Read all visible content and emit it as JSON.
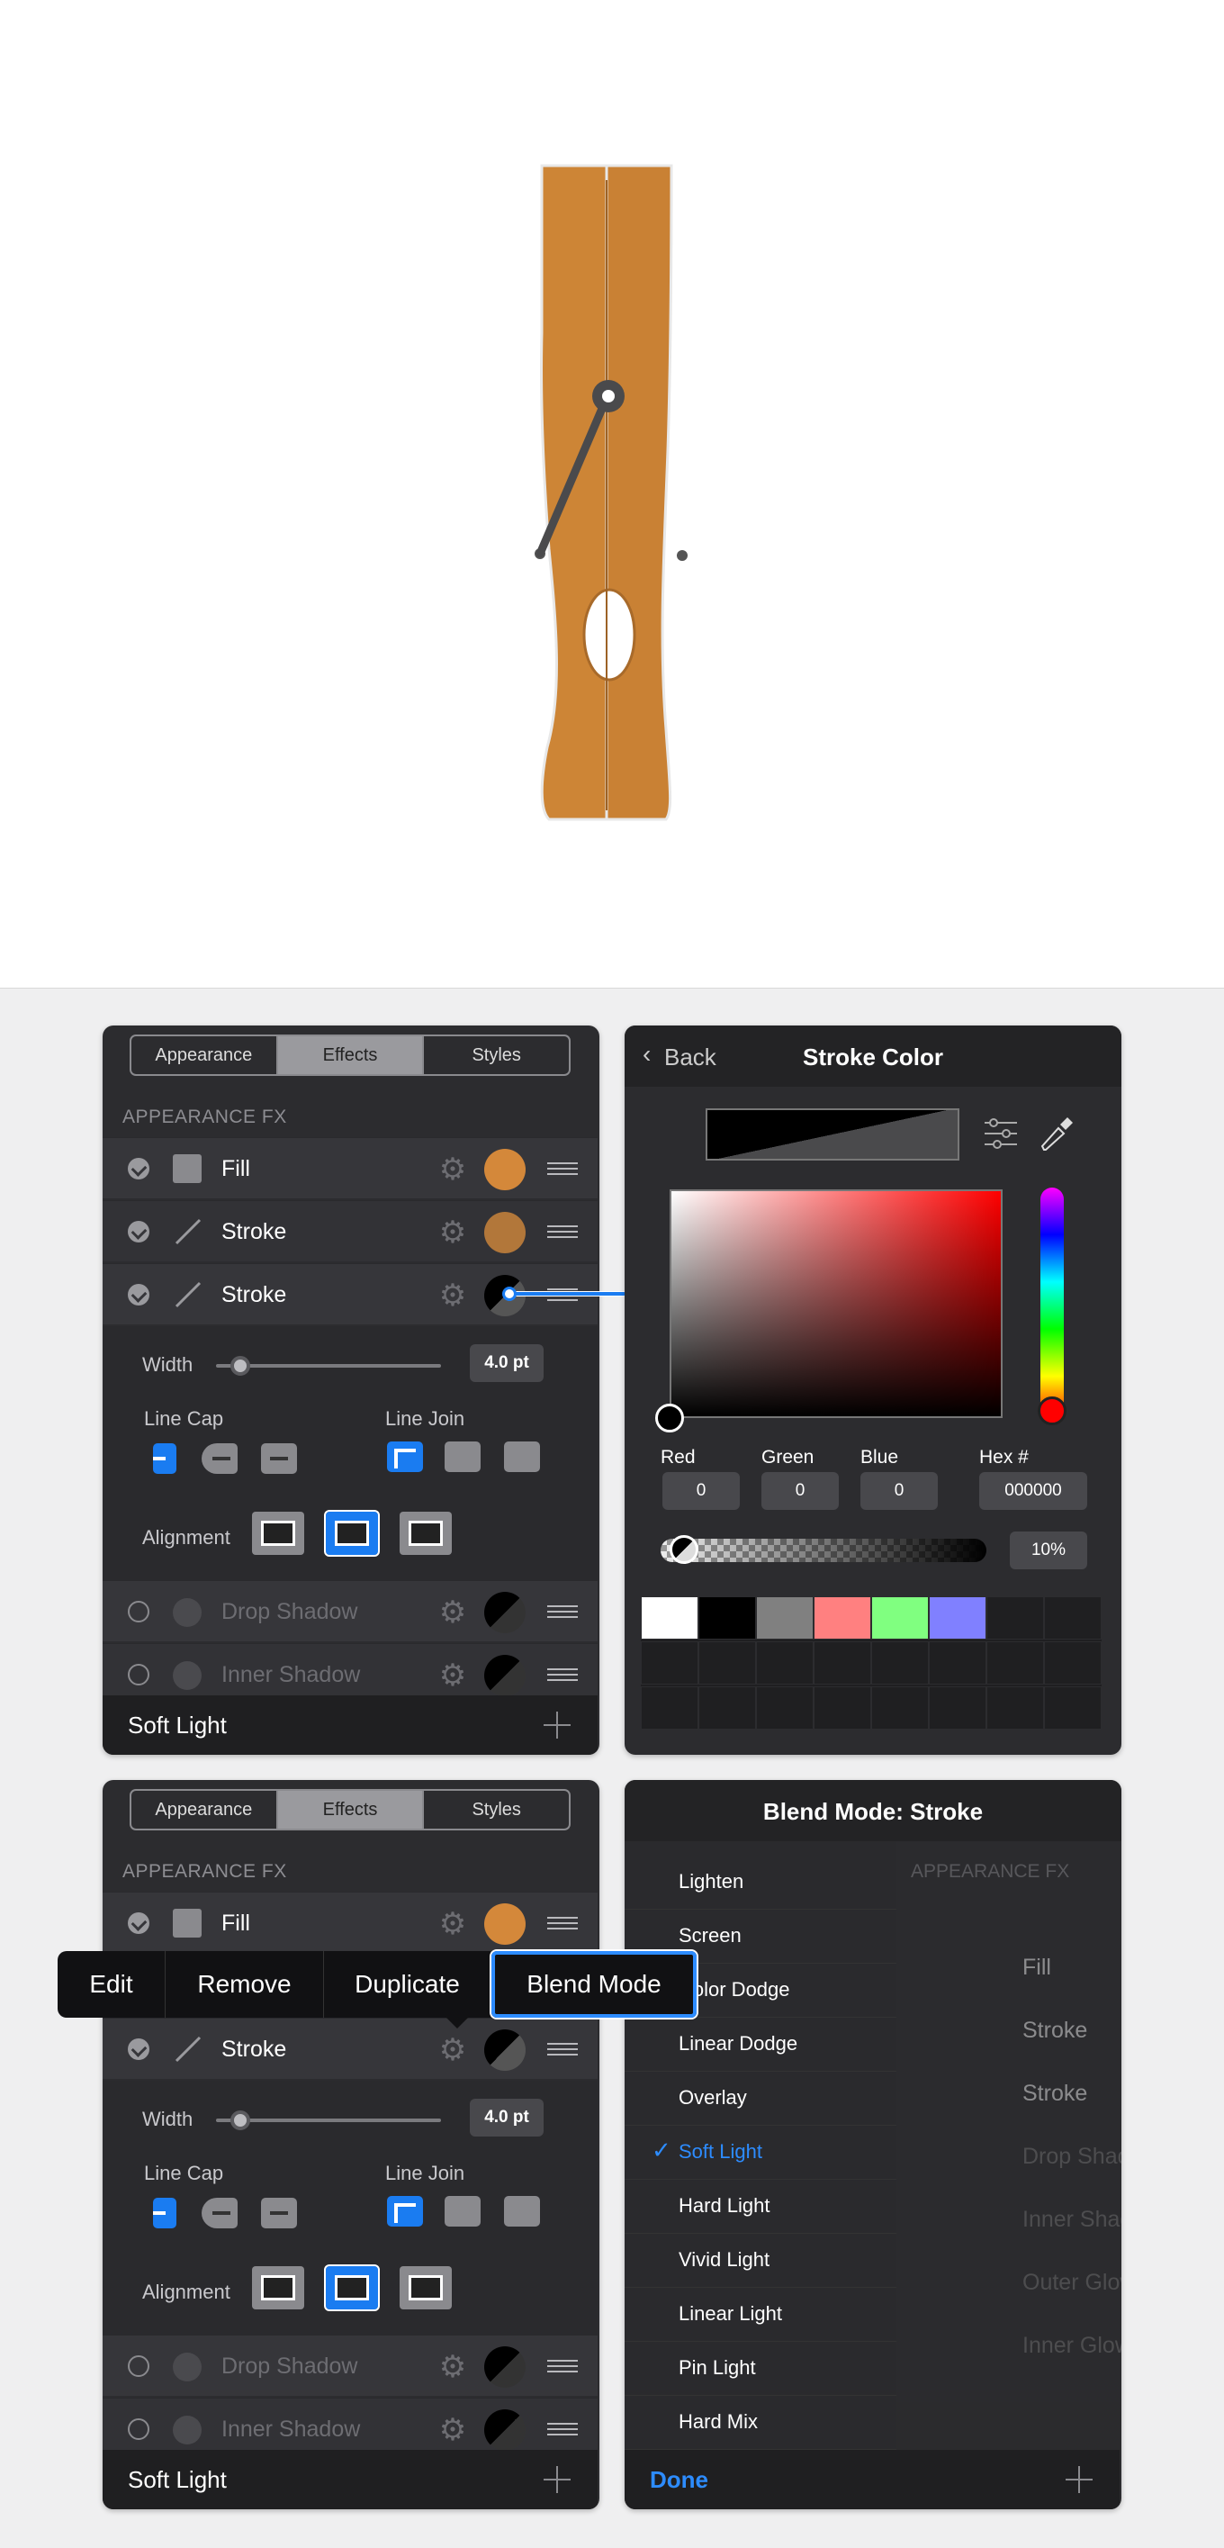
{
  "tabs": {
    "appearance": "Appearance",
    "effects": "Effects",
    "styles": "Styles"
  },
  "section_title": "APPEARANCE FX",
  "rows": {
    "fill": "Fill",
    "stroke": "Stroke",
    "drop_shadow": "Drop Shadow",
    "inner_shadow": "Inner Shadow",
    "outer_glow": "Outer Glow",
    "inner_glow": "Inner Glow"
  },
  "stroke_opts": {
    "width_label": "Width",
    "width_value": "4.0 pt",
    "width_fraction": 0.1,
    "line_cap": "Line Cap",
    "line_join": "Line Join",
    "alignment": "Alignment"
  },
  "footer_blend": "Soft Light",
  "colors": {
    "fill": "#d4883a",
    "stroke": "#b2773a",
    "accent": "#1a7cf1",
    "clothespin": "#cd8536"
  },
  "stroke_color": {
    "back": "Back",
    "title": "Stroke Color",
    "red_label": "Red",
    "green_label": "Green",
    "blue_label": "Blue",
    "hex_label": "Hex #",
    "red": "0",
    "green": "0",
    "blue": "0",
    "hex": "000000",
    "opacity": "10%",
    "swatches": [
      "#ffffff",
      "#000000",
      "#808080",
      "#ff8080",
      "#80ff80",
      "#8080ff"
    ]
  },
  "context_menu": {
    "edit": "Edit",
    "remove": "Remove",
    "duplicate": "Duplicate",
    "blend_mode": "Blend Mode"
  },
  "blend": {
    "title": "Blend Mode: Stroke",
    "modes": [
      "Lighten",
      "Screen",
      "Color Dodge",
      "Linear Dodge",
      "Overlay",
      "Soft Light",
      "Hard Light",
      "Vivid Light",
      "Linear Light",
      "Pin Light",
      "Hard Mix"
    ],
    "selected": "Soft Light",
    "check": "✓",
    "done": "Done"
  }
}
